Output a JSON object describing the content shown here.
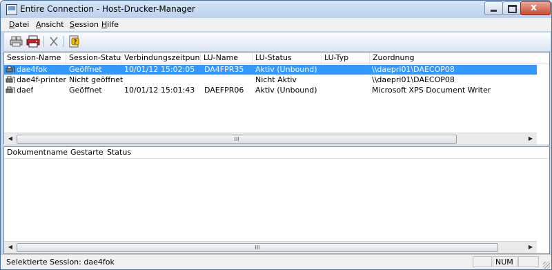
{
  "window": {
    "title": "Entire Connection - Host-Drucker-Manager"
  },
  "window_buttons": {
    "close_glyph": "x"
  },
  "menu": [
    {
      "label": "Datei",
      "underline": "D",
      "rest": "atei"
    },
    {
      "label": "Ansicht",
      "underline": "A",
      "rest": "nsicht"
    },
    {
      "label": "Session",
      "underline": "S",
      "rest": "ession"
    },
    {
      "label": "Hilfe",
      "underline": "H",
      "rest": "ilfe"
    }
  ],
  "toolbar": {
    "icons": [
      "printer-connect-icon",
      "printer-red-icon",
      "delete-x-icon",
      "help-page-icon"
    ]
  },
  "sessions_table": {
    "columns": [
      "Session-Name",
      "Session-Status",
      "Verbindungszeitpunkt",
      "LU-Name",
      "LU-Status",
      "LU-Typ",
      "Zuordnung"
    ],
    "rows": [
      {
        "name": "dae4fok",
        "status": "Geöffnet",
        "time": "10/01/12 15:02:05",
        "lu_name": "DA4FPR35",
        "lu_status": "Aktiv (Unbound)",
        "lu_type": "",
        "assignment": "\\\\daepri01\\DAECOP08",
        "selected": true
      },
      {
        "name": "dae4f-printer",
        "status": "Nicht geöffnet",
        "time": "",
        "lu_name": "",
        "lu_status": "Nicht Aktiv",
        "lu_type": "",
        "assignment": "\\\\daepri01\\DAECOP08",
        "selected": false
      },
      {
        "name": "daef",
        "status": "Geöffnet",
        "time": "10/01/12 15:01:43",
        "lu_name": "DAEFPR06",
        "lu_status": "Aktiv (Unbound)",
        "lu_type": "",
        "assignment": "Microsoft XPS Document Writer",
        "selected": false
      }
    ]
  },
  "documents_table": {
    "columns": [
      "Dokumentname",
      "Gestartet",
      "Status"
    ]
  },
  "scrollbar": {
    "left_arrow": "◀",
    "right_arrow": "▶",
    "thumb_grip": "III"
  },
  "statusbar": {
    "text": "Selektierte Session: dae4fok",
    "num": "NUM"
  },
  "colors": {
    "selection": "#3399ff",
    "frame": "#c4d8ef"
  }
}
